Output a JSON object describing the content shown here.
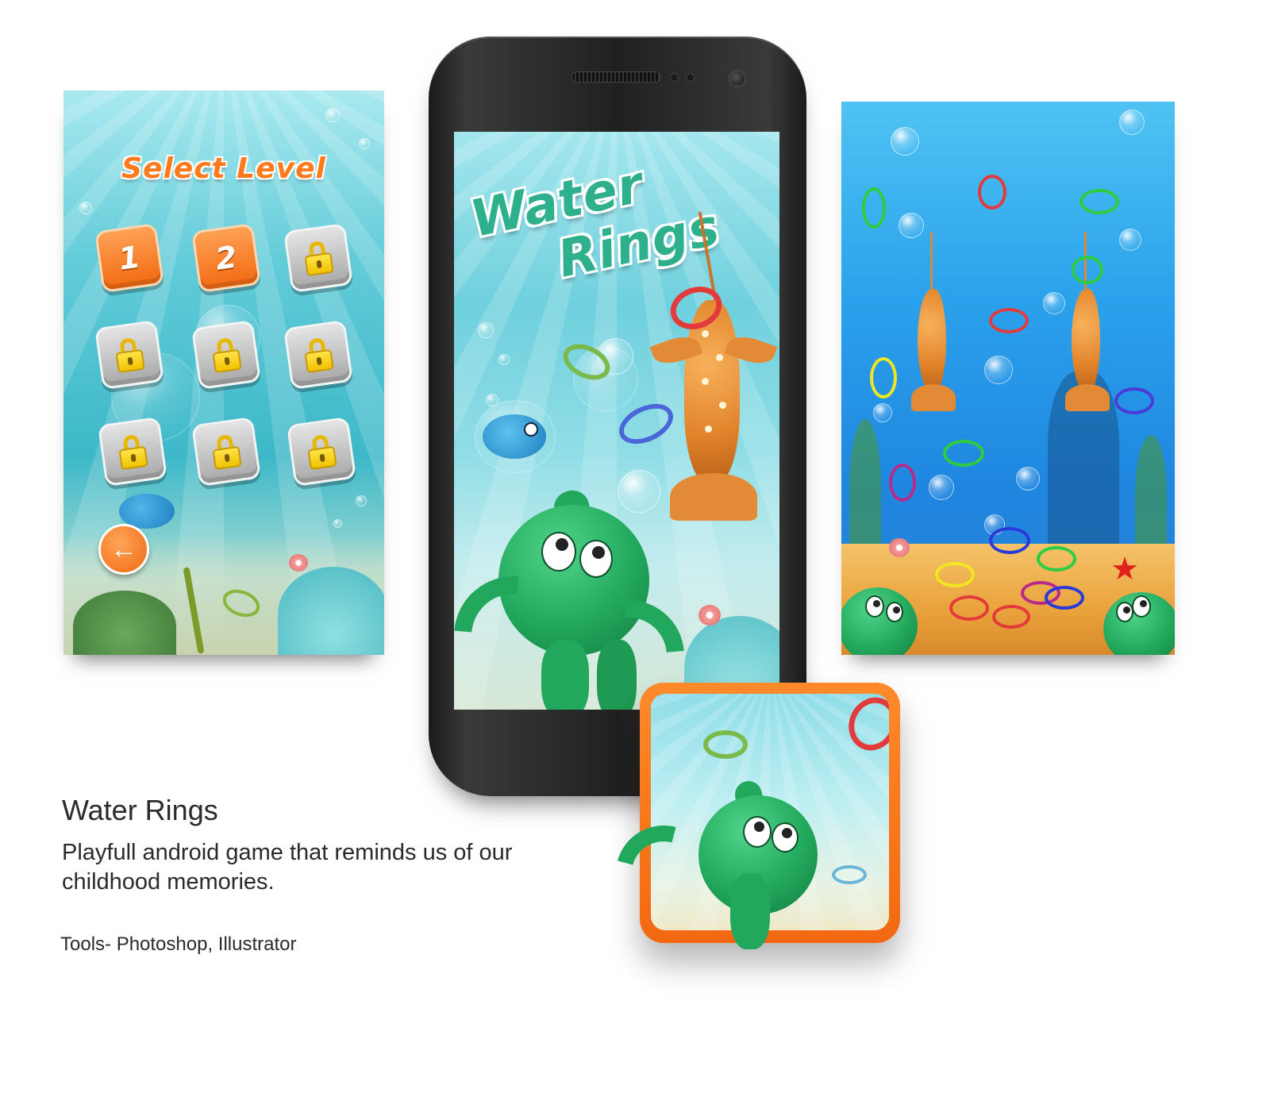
{
  "level_select": {
    "title": "Select Level",
    "levels": [
      {
        "label": "1",
        "locked": false
      },
      {
        "label": "2",
        "locked": false
      },
      {
        "label": "",
        "locked": true
      },
      {
        "label": "",
        "locked": true
      },
      {
        "label": "",
        "locked": true
      },
      {
        "label": "",
        "locked": true
      },
      {
        "label": "",
        "locked": true
      },
      {
        "label": "",
        "locked": true
      },
      {
        "label": "",
        "locked": true
      }
    ],
    "back_icon": "arrow-left-icon",
    "lock_icon": "padlock-icon"
  },
  "splash": {
    "title_line1": "Water",
    "title_line2": "Rings"
  },
  "caption": {
    "title": "Water Rings",
    "description": "Playfull android game that reminds us of our childhood memories.",
    "tools": "Tools- Photoshop, Illustrator"
  },
  "colors": {
    "accent_orange": "#f26a12",
    "octopus_green": "#22a85c",
    "title_teal": "#2fb08c",
    "deep_water": "#1f86e0"
  }
}
